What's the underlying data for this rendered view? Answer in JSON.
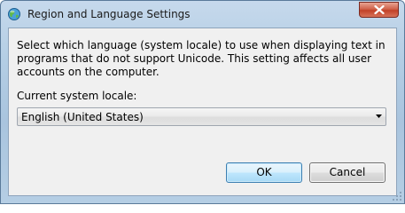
{
  "window": {
    "title": "Region and Language Settings"
  },
  "dialog": {
    "description": "Select which language (system locale) to use when displaying text in programs that do not support Unicode. This setting affects all user accounts on the computer.",
    "locale_label": "Current system locale:",
    "locale_select": {
      "selected": "English (United States)"
    },
    "buttons": {
      "ok": "OK",
      "cancel": "Cancel"
    }
  },
  "colors": {
    "titlebar": "#b3cde4",
    "close_button": "#c24128",
    "client_background": "#f0f0f0",
    "default_button_border": "#3c7fb1"
  },
  "icons": {
    "app": "globe-icon",
    "close": "close-icon",
    "dropdown": "chevron-down-icon"
  }
}
